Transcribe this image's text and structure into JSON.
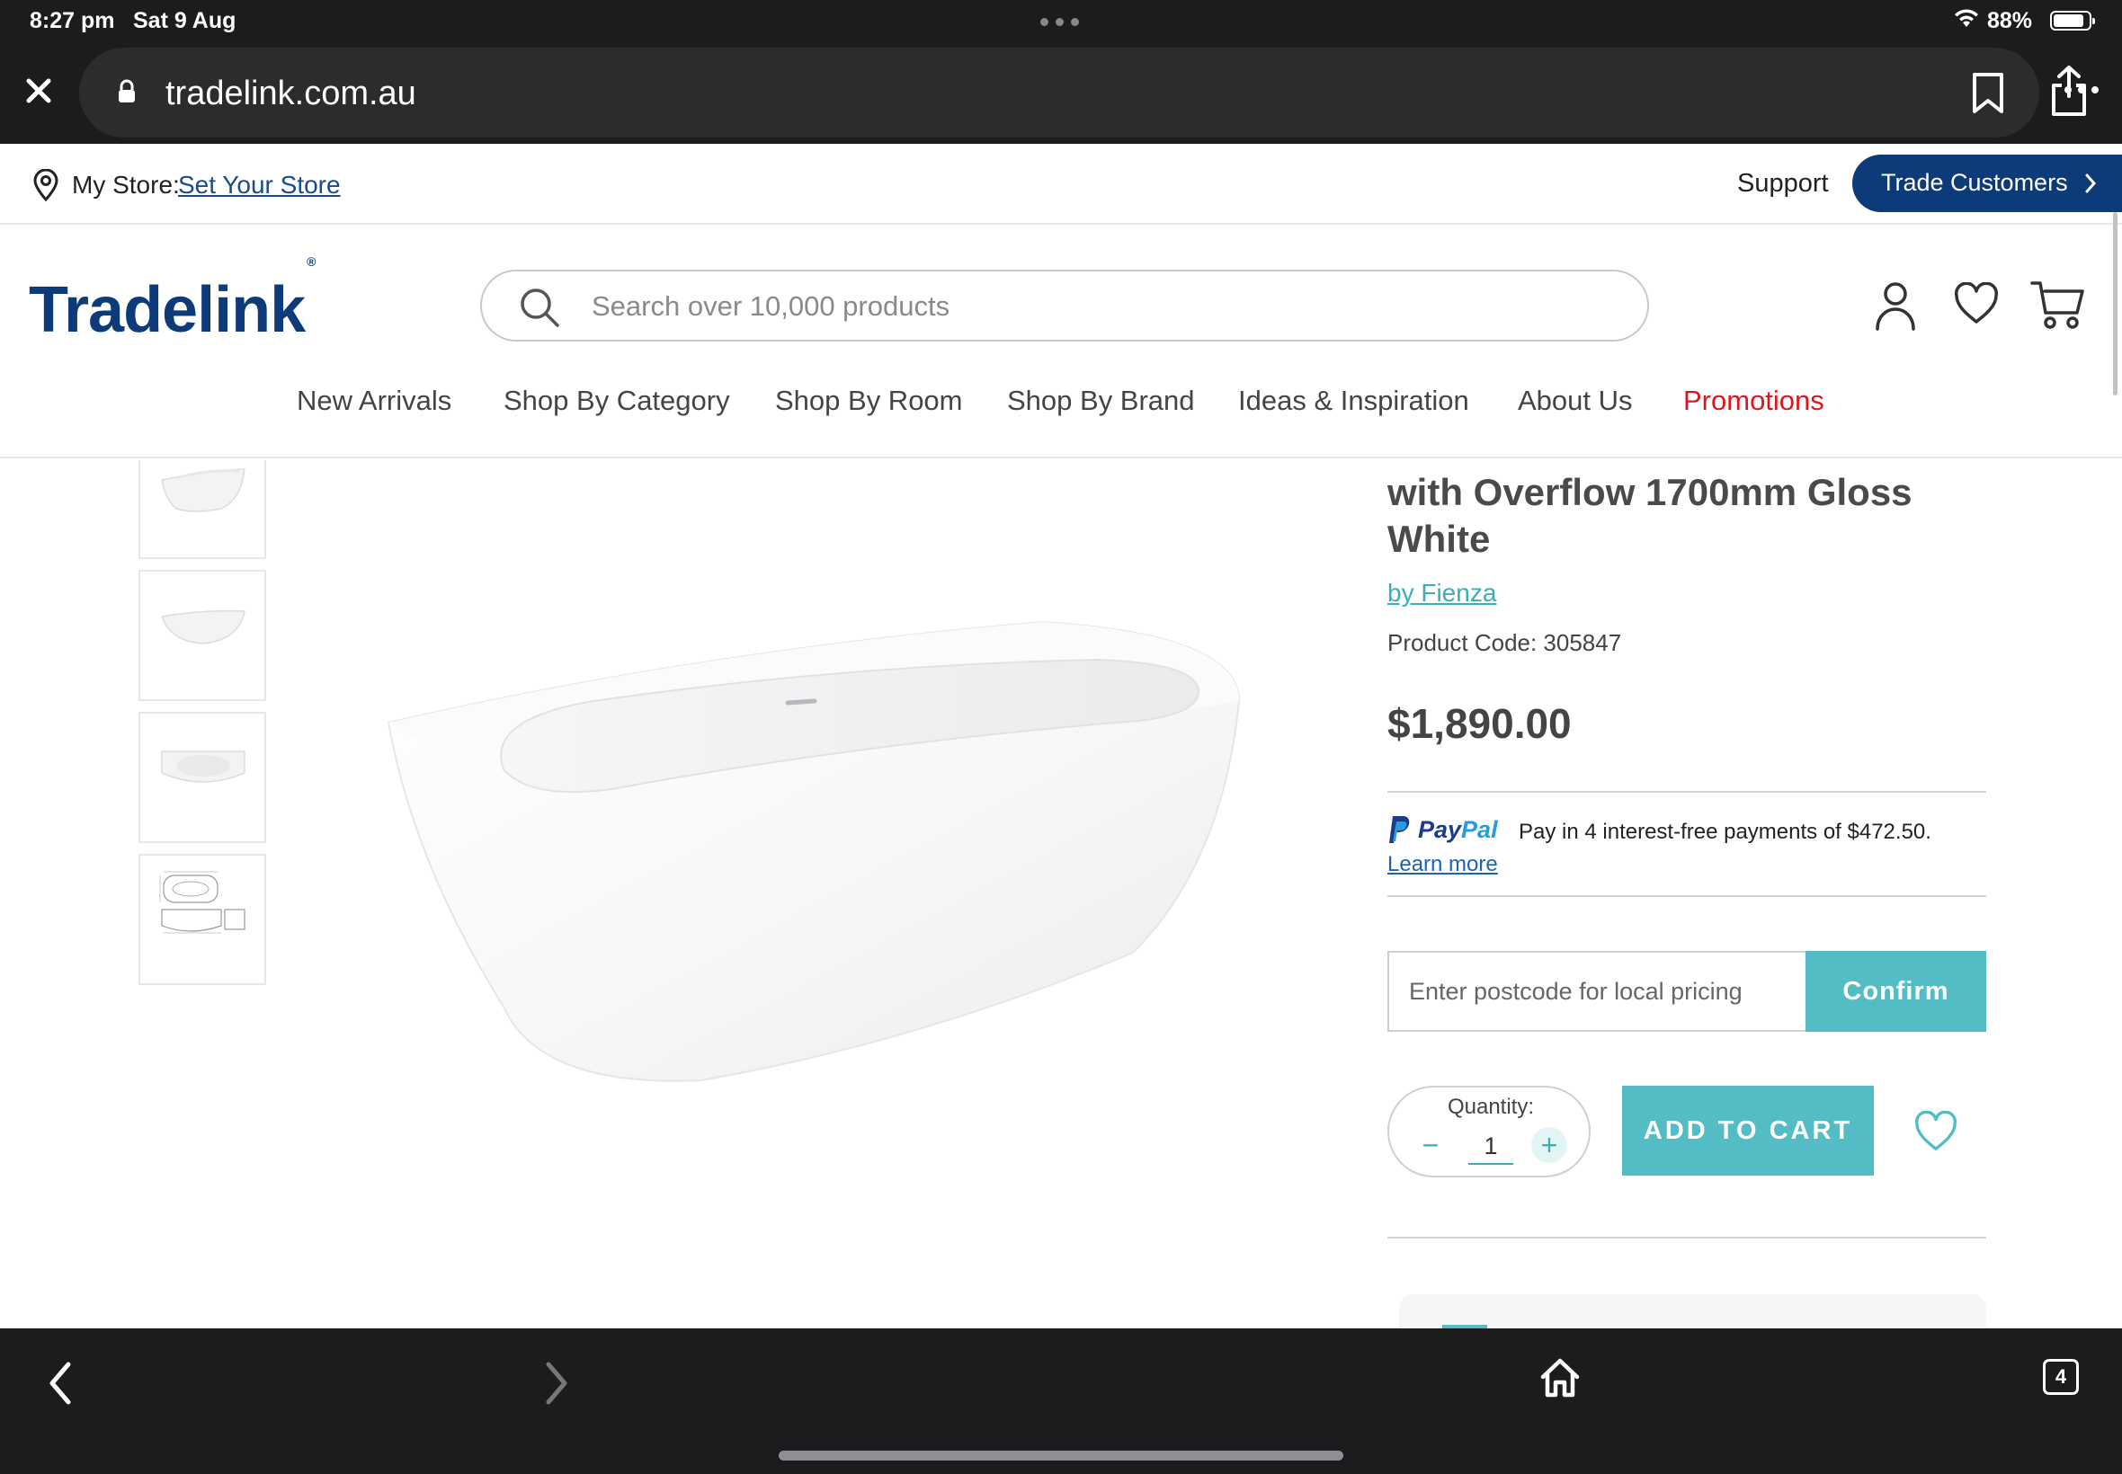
{
  "status_bar": {
    "time": "8:27 pm",
    "date": "Sat 9 Aug",
    "battery": "88%",
    "battery_level": 0.88
  },
  "browser": {
    "url": "tradelink.com.au",
    "tab_count": "4"
  },
  "utility_bar": {
    "my_store_label": "My Store:",
    "set_store_link": "Set Your Store",
    "support": "Support",
    "trade_customers": "Trade Customers"
  },
  "header": {
    "logo_text": "Tradelink",
    "logo_mark": "®",
    "search_placeholder": "Search over 10,000 products"
  },
  "nav": {
    "items": [
      {
        "label": "New Arrivals"
      },
      {
        "label": "Shop By Category"
      },
      {
        "label": "Shop By Room"
      },
      {
        "label": "Shop By Brand"
      },
      {
        "label": "Ideas & Inspiration"
      },
      {
        "label": "About Us"
      },
      {
        "label": "Promotions"
      }
    ]
  },
  "product": {
    "title_line_1": "with Overflow 1700mm Gloss",
    "title_line_2": "White",
    "brand": "by Fienza",
    "code": "Product Code: 305847",
    "price": "$1,890.00",
    "paypal": {
      "pay": "Pay",
      "pal": "Pal",
      "message": "Pay in 4 interest-free payments of $472.50.",
      "learn_more": "Learn more"
    },
    "postcode_placeholder": "Enter postcode for local pricing",
    "confirm": "Confirm",
    "quantity_label": "Quantity:",
    "quantity_value": "1",
    "quantity_minus": "−",
    "quantity_plus": "+",
    "add_to_cart": "ADD TO CART"
  },
  "colors": {
    "brand_navy": "#0d3b7a",
    "accent_teal": "#53bcc4",
    "promo_red": "#d71920",
    "browser_chrome": "#1c1c1e"
  },
  "icons": [
    "close-icon",
    "lock-icon",
    "bookmark-icon",
    "share-icon",
    "more-icon",
    "map-pin-icon",
    "chevron-right-icon",
    "search-icon",
    "account-icon",
    "heart-icon",
    "cart-icon",
    "back-icon",
    "forward-icon",
    "home-icon",
    "tabs-icon"
  ]
}
